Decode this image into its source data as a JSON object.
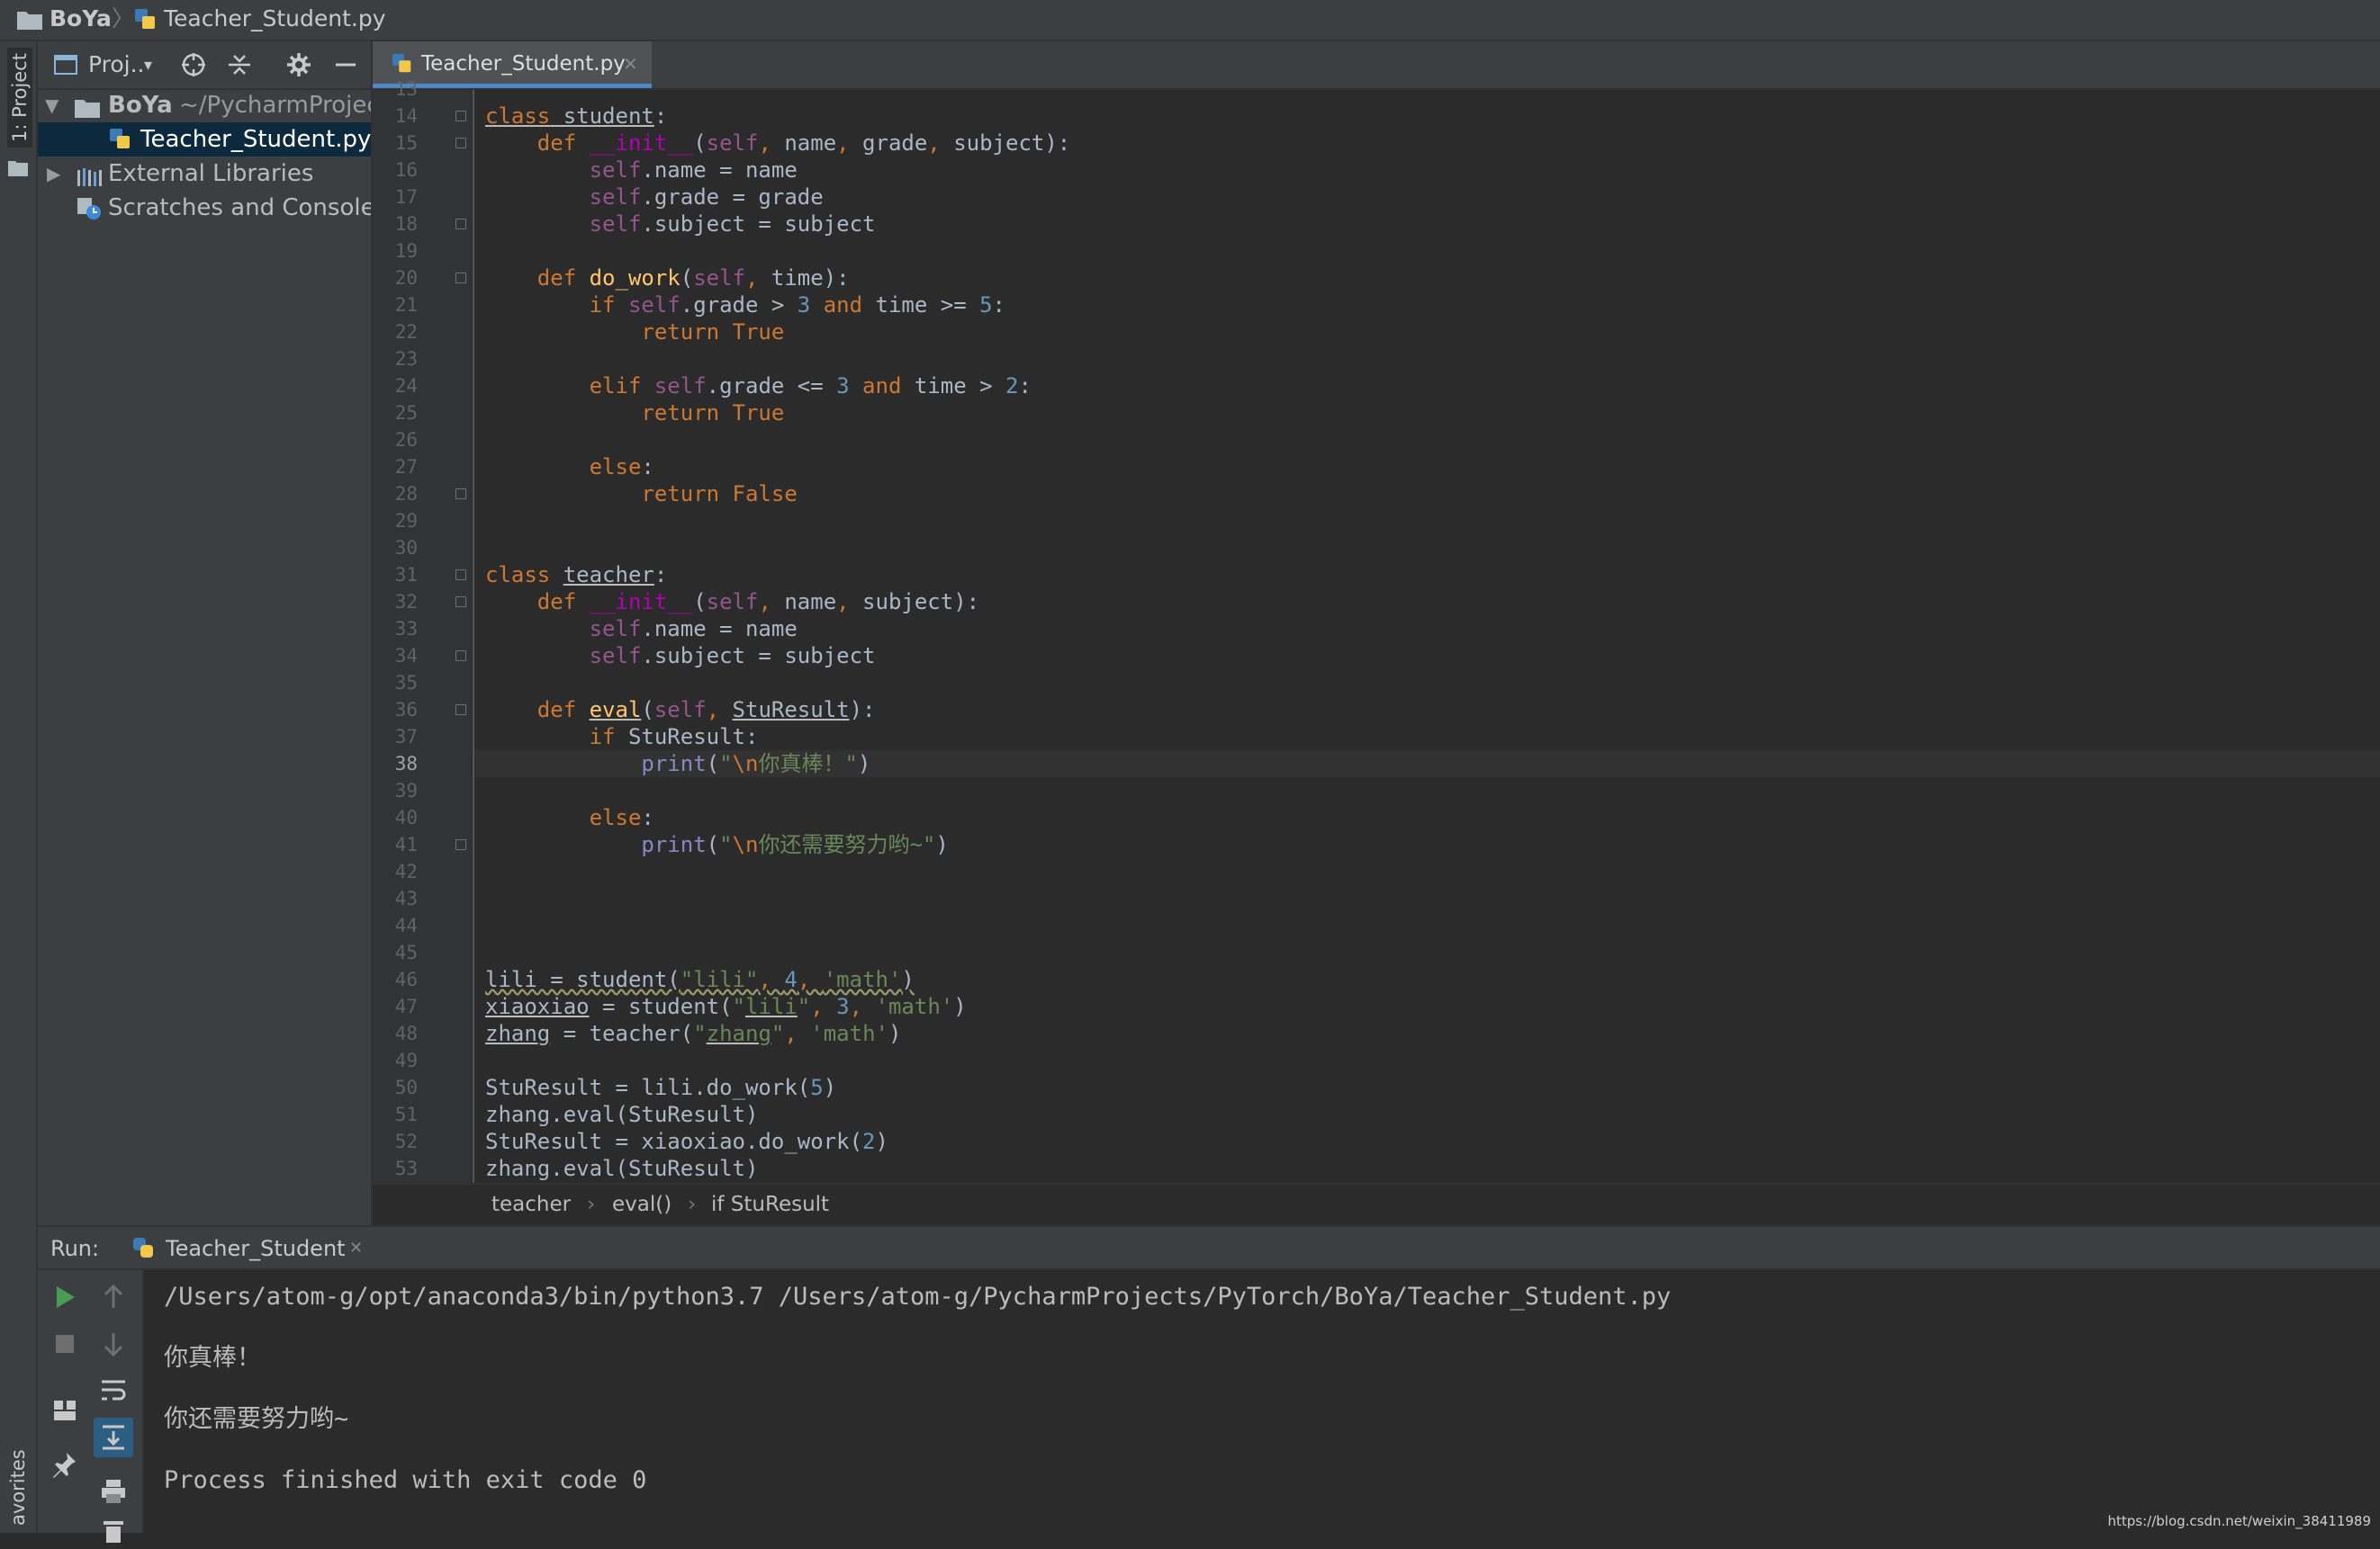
{
  "nav": {
    "project": "BoYa",
    "file": "Teacher_Student.py"
  },
  "stripe": {
    "project_tab": "1: Project",
    "favorites_tab": "avorites"
  },
  "project_panel": {
    "title": "Proj..",
    "tree": [
      {
        "label": "BoYa",
        "path": "~/PycharmProjec"
      },
      {
        "label": "Teacher_Student.py"
      },
      {
        "label": "External Libraries"
      },
      {
        "label": "Scratches and Consoles"
      }
    ]
  },
  "editor": {
    "tab": "Teacher_Student.py",
    "first_line": 13,
    "current_line": 38,
    "lines": [
      [],
      [
        [
          "kw ul",
          "class"
        ],
        [
          "ul",
          " student"
        ],
        [
          "",
          ":"
        ]
      ],
      [
        [
          "",
          "    "
        ],
        [
          "kw",
          "def "
        ],
        [
          "dunder",
          "__init__"
        ],
        [
          "",
          "("
        ],
        [
          "self",
          "self"
        ],
        [
          "kw",
          ", "
        ],
        [
          "",
          "name"
        ],
        [
          "kw",
          ", "
        ],
        [
          "",
          "grade"
        ],
        [
          "kw",
          ", "
        ],
        [
          "",
          "subject):"
        ]
      ],
      [
        [
          "",
          "        "
        ],
        [
          "self",
          "self"
        ],
        [
          "",
          ".name = name"
        ]
      ],
      [
        [
          "",
          "        "
        ],
        [
          "self",
          "self"
        ],
        [
          "",
          ".grade = grade"
        ]
      ],
      [
        [
          "",
          "        "
        ],
        [
          "self",
          "self"
        ],
        [
          "",
          ".subject = subject"
        ]
      ],
      [],
      [
        [
          "",
          "    "
        ],
        [
          "kw",
          "def "
        ],
        [
          "fn",
          "do_work"
        ],
        [
          "",
          "("
        ],
        [
          "self",
          "self"
        ],
        [
          "kw",
          ", "
        ],
        [
          "",
          "time):"
        ]
      ],
      [
        [
          "",
          "        "
        ],
        [
          "kw",
          "if "
        ],
        [
          "self",
          "self"
        ],
        [
          "",
          ".grade > "
        ],
        [
          "num",
          "3"
        ],
        [
          "kw",
          " and "
        ],
        [
          "",
          "time >= "
        ],
        [
          "num",
          "5"
        ],
        [
          "",
          ":"
        ]
      ],
      [
        [
          "",
          "            "
        ],
        [
          "kw",
          "return True"
        ]
      ],
      [],
      [
        [
          "",
          "        "
        ],
        [
          "kw",
          "elif "
        ],
        [
          "self",
          "self"
        ],
        [
          "",
          ".grade <= "
        ],
        [
          "num",
          "3"
        ],
        [
          "kw",
          " and "
        ],
        [
          "",
          "time > "
        ],
        [
          "num",
          "2"
        ],
        [
          "",
          ":"
        ]
      ],
      [
        [
          "",
          "            "
        ],
        [
          "kw",
          "return True"
        ]
      ],
      [],
      [
        [
          "",
          "        "
        ],
        [
          "kw",
          "else"
        ],
        [
          "",
          ":"
        ]
      ],
      [
        [
          "",
          "            "
        ],
        [
          "kw",
          "return False"
        ]
      ],
      [],
      [],
      [
        [
          "kw",
          "class "
        ],
        [
          "ul",
          "teacher"
        ],
        [
          "",
          ":"
        ]
      ],
      [
        [
          "",
          "    "
        ],
        [
          "kw",
          "def "
        ],
        [
          "dunder",
          "__init__"
        ],
        [
          "",
          "("
        ],
        [
          "self",
          "self"
        ],
        [
          "kw",
          ", "
        ],
        [
          "",
          "name"
        ],
        [
          "kw",
          ", "
        ],
        [
          "",
          "subject):"
        ]
      ],
      [
        [
          "",
          "        "
        ],
        [
          "self",
          "self"
        ],
        [
          "",
          ".name = name"
        ]
      ],
      [
        [
          "",
          "        "
        ],
        [
          "self",
          "self"
        ],
        [
          "",
          ".subject = subject"
        ]
      ],
      [],
      [
        [
          "",
          "    "
        ],
        [
          "kw",
          "def "
        ],
        [
          "fn ul",
          "eval"
        ],
        [
          "",
          "("
        ],
        [
          "self",
          "self"
        ],
        [
          "kw",
          ", "
        ],
        [
          "ul",
          "StuResult"
        ],
        [
          "",
          "):"
        ]
      ],
      [
        [
          "",
          "        "
        ],
        [
          "kw",
          "if "
        ],
        [
          "",
          "StuResult:"
        ]
      ],
      [
        [
          "",
          "            "
        ],
        [
          "builtin",
          "print"
        ],
        [
          "",
          "("
        ],
        [
          "str",
          "\""
        ],
        [
          "esc",
          "\\n"
        ],
        [
          "str",
          "你真棒！\""
        ],
        [
          "",
          ")"
        ]
      ],
      [],
      [
        [
          "",
          "        "
        ],
        [
          "kw",
          "else"
        ],
        [
          "",
          ":"
        ]
      ],
      [
        [
          "",
          "            "
        ],
        [
          "builtin",
          "print"
        ],
        [
          "",
          "("
        ],
        [
          "str",
          "\""
        ],
        [
          "esc",
          "\\n"
        ],
        [
          "str",
          "你还需要努力哟~\""
        ],
        [
          "",
          ")"
        ]
      ],
      [],
      [],
      [],
      [],
      [
        [
          "wavy",
          "lili = student("
        ],
        [
          "str wavy",
          "\"lili\""
        ],
        [
          "kw wavy",
          ", "
        ],
        [
          "num wavy",
          "4"
        ],
        [
          "kw wavy",
          ", "
        ],
        [
          "str wavy",
          "'math'"
        ],
        [
          "wavy",
          ")"
        ]
      ],
      [
        [
          "ul",
          "xiaoxiao"
        ],
        [
          "",
          " = student("
        ],
        [
          "str",
          "\""
        ],
        [
          "str ul",
          "lili"
        ],
        [
          "str",
          "\""
        ],
        [
          "kw",
          ", "
        ],
        [
          "num",
          "3"
        ],
        [
          "kw",
          ", "
        ],
        [
          "str",
          "'math'"
        ],
        [
          "",
          ")"
        ]
      ],
      [
        [
          "ul",
          "zhang"
        ],
        [
          "",
          " = teacher("
        ],
        [
          "str",
          "\""
        ],
        [
          "str ul",
          "zhang"
        ],
        [
          "str",
          "\""
        ],
        [
          "kw",
          ", "
        ],
        [
          "str",
          "'math'"
        ],
        [
          "",
          ")"
        ]
      ],
      [],
      [
        [
          "",
          "StuResult = lili.do_work("
        ],
        [
          "num",
          "5"
        ],
        [
          "",
          ")"
        ]
      ],
      [
        [
          "",
          "zhang.eval(StuResult)"
        ]
      ],
      [
        [
          "",
          "StuResult = xiaoxiao.do_work("
        ],
        [
          "num",
          "2"
        ],
        [
          "",
          ")"
        ]
      ],
      [
        [
          "",
          "zhang.eval(StuResult)"
        ]
      ]
    ]
  },
  "breadcrumb": [
    "teacher",
    "eval()",
    "if StuResult"
  ],
  "run": {
    "label": "Run:",
    "tab": "Teacher_Student",
    "output": [
      "/Users/atom-g/opt/anaconda3/bin/python3.7 /Users/atom-g/PycharmProjects/PyTorch/BoYa/Teacher_Student.py",
      "你真棒！",
      "你还需要努力哟~",
      "Process finished with exit code 0"
    ]
  },
  "watermark": "https://blog.csdn.net/weixin_38411989",
  "colors": {
    "keyword": "#cc7832",
    "self": "#94558d",
    "number": "#6897bb",
    "string": "#6a8759",
    "function": "#ffc66d",
    "selection": "#0d293e",
    "run_green": "#499c54"
  }
}
